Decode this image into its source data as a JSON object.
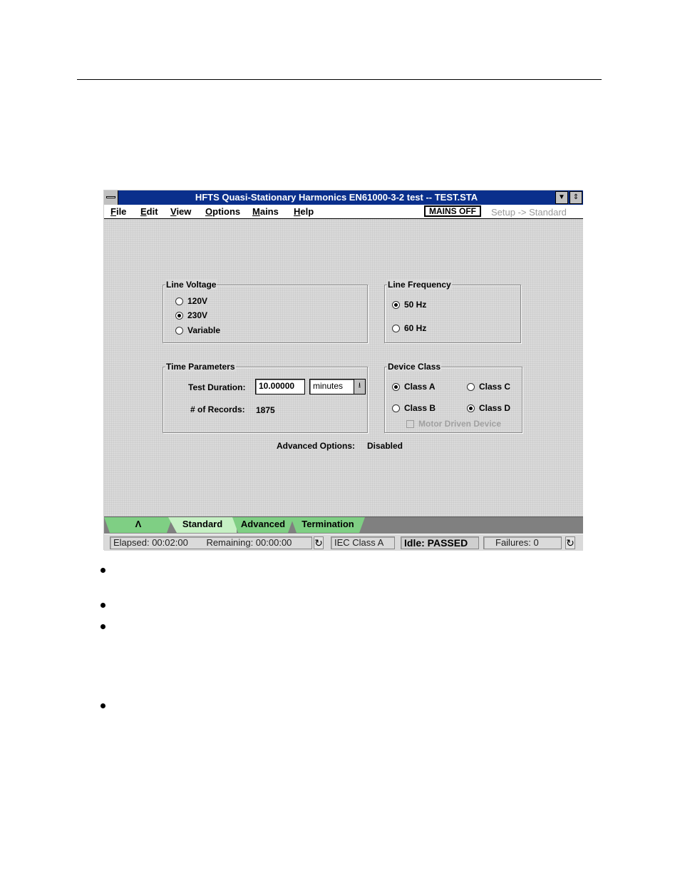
{
  "window": {
    "title": "HFTS Quasi-Stationary Harmonics EN61000-3-2 test -- TEST.STA",
    "minimize_icon": "down-triangle-icon",
    "restore_icon": "up-down-arrows-icon"
  },
  "menubar": {
    "items": [
      {
        "label": "File",
        "accel": "F"
      },
      {
        "label": "Edit",
        "accel": "E"
      },
      {
        "label": "View",
        "accel": "V"
      },
      {
        "label": "Options",
        "accel": "O"
      },
      {
        "label": "Mains",
        "accel": "M"
      },
      {
        "label": "Help",
        "accel": "H"
      }
    ],
    "mains_status": "MAINS OFF",
    "mode_breadcrumb": "Setup -> Standard"
  },
  "line_voltage": {
    "title": "Line Voltage",
    "options": [
      {
        "label": "120V",
        "selected": false
      },
      {
        "label": "230V",
        "selected": true
      },
      {
        "label": "Variable",
        "selected": false
      }
    ]
  },
  "line_frequency": {
    "title": "Line Frequency",
    "options": [
      {
        "label": "50 Hz",
        "selected": true
      },
      {
        "label": "60 Hz",
        "selected": false
      }
    ]
  },
  "time_parameters": {
    "title": "Time Parameters",
    "test_duration_label": "Test Duration:",
    "test_duration_value": "10.00000",
    "unit_value": "minutes",
    "records_label": "# of Records:",
    "records_value": "1875"
  },
  "device_class": {
    "title": "Device Class",
    "options": [
      {
        "label": "Class A",
        "selected": true
      },
      {
        "label": "Class C",
        "selected": false
      },
      {
        "label": "Class B",
        "selected": false
      },
      {
        "label": "Class D",
        "selected": true
      }
    ],
    "motor_driven_label": "Motor Driven Device",
    "motor_driven_checked": false
  },
  "advanced_options": {
    "label": "Advanced Options:",
    "value": "Disabled"
  },
  "tabs": [
    {
      "label": "Λ",
      "active": false
    },
    {
      "label": "Standard",
      "active": true
    },
    {
      "label": "Advanced",
      "active": false
    },
    {
      "label": "Termination",
      "active": false
    }
  ],
  "statusbar": {
    "elapsed": "Elapsed: 00:02:00",
    "remaining": "Remaining: 00:00:00",
    "iec_class": "IEC Class A",
    "state": "Idle: PASSED",
    "failures": "Failures: 0",
    "refresh_icon": "↻"
  },
  "document": {
    "bullet_count": 4
  }
}
